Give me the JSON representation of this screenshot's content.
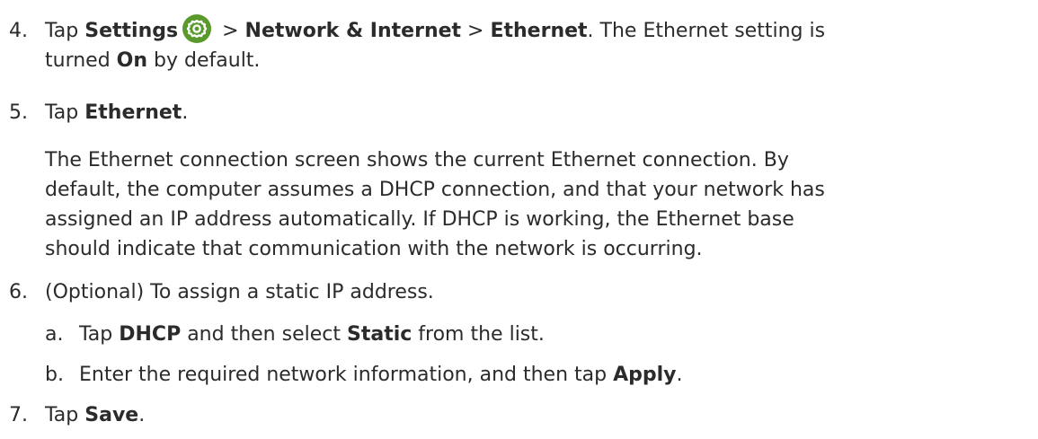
{
  "steps": [
    {
      "number": "4.",
      "parts": {
        "tap": "Tap ",
        "settings": "Settings",
        "sep1": " > ",
        "network": "Network & Internet",
        "sep2": " > ",
        "ethernet": "Ethernet",
        "rest1": ". The Ethernet setting is",
        "turned": "turned ",
        "on": "On",
        "rest2": " by default."
      },
      "icon": "settings-gear-icon",
      "icon_color": "#5a9a2c"
    },
    {
      "number": "5.",
      "parts": {
        "tap": "Tap ",
        "ethernet": "Ethernet",
        "end": "."
      },
      "paragraph": [
        "The Ethernet connection screen shows the current Ethernet connection. By",
        "default, the computer assumes a DHCP connection, and that your network has",
        "assigned an IP address automatically. If DHCP is working, the Ethernet base",
        "should indicate that communication with the network is occurring."
      ]
    },
    {
      "number": "6.",
      "text": "(Optional) To assign a static IP address.",
      "substeps": [
        {
          "letter": "a.",
          "tap": "Tap ",
          "dhcp": "DHCP",
          "mid": " and then select ",
          "static": "Static",
          "end": " from the list."
        },
        {
          "letter": "b.",
          "text": "Enter the required network information, and then tap ",
          "apply": "Apply",
          "end": "."
        }
      ]
    },
    {
      "number": "7.",
      "parts": {
        "tap": "Tap ",
        "save": "Save",
        "end": "."
      }
    }
  ]
}
